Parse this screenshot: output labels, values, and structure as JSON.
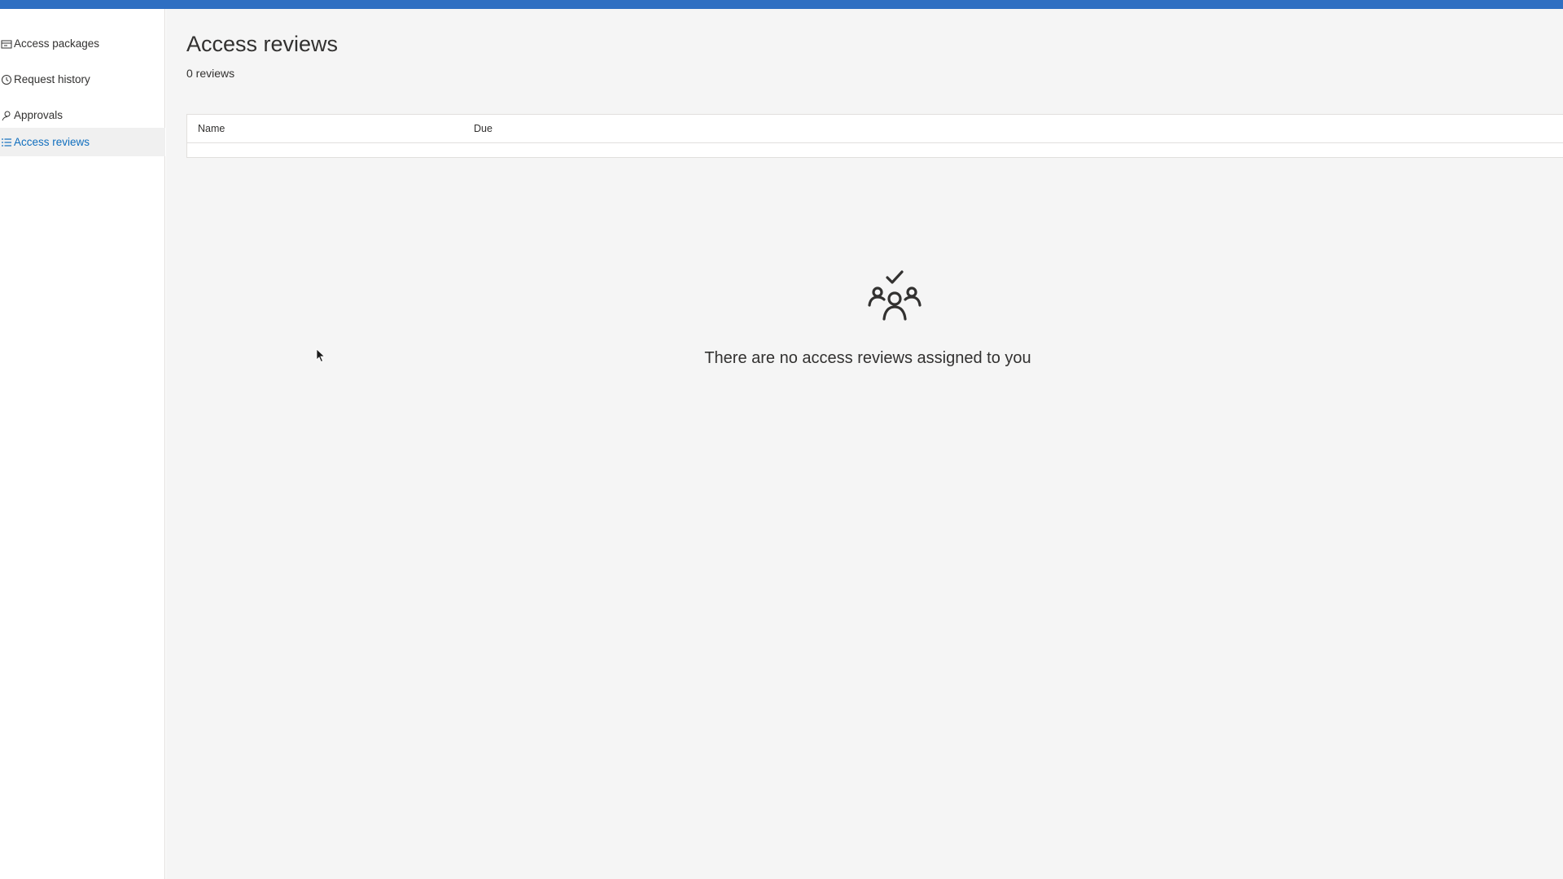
{
  "colors": {
    "topbar": "#2f6fc2",
    "accent": "#106ebe",
    "main_background": "#f5f5f5",
    "sidebar_background": "#ffffff"
  },
  "sidebar": {
    "items": [
      {
        "label": "Access packages",
        "icon": "package-icon",
        "active": false
      },
      {
        "label": "Request history",
        "icon": "history-clock-icon",
        "active": false
      },
      {
        "label": "Approvals",
        "icon": "person-icon",
        "active": false
      },
      {
        "label": "Access reviews",
        "icon": "list-icon",
        "active": true
      }
    ]
  },
  "main": {
    "title": "Access reviews",
    "count_text": "0 reviews",
    "table": {
      "columns": [
        "Name",
        "Due"
      ],
      "rows": []
    },
    "empty_state": {
      "icon": "group-checkmark-icon",
      "message": "There are no access reviews assigned to you"
    }
  }
}
